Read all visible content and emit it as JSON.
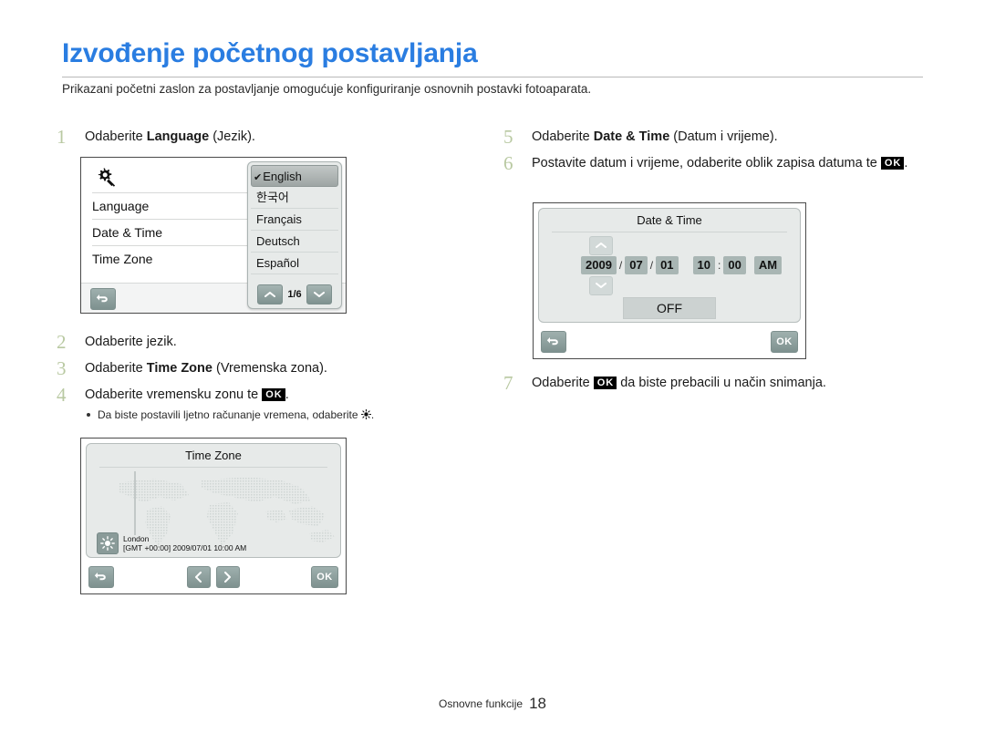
{
  "header": {
    "title": "Izvođenje početnog postavljanja",
    "subtitle": "Prikazani početni zaslon za postavljanje omogućuje konfiguriranje osnovnih postavki fotoaparata.",
    "title_color": "#2a7de1"
  },
  "steps_left": [
    {
      "num": "1",
      "pre": "Odaberite ",
      "bold": "Language",
      "post": " (Jezik)."
    },
    {
      "num": "2",
      "pre": "Odaberite jezik.",
      "bold": "",
      "post": ""
    },
    {
      "num": "3",
      "pre": "Odaberite ",
      "bold": "Time Zone",
      "post": " (Vremenska zona)."
    },
    {
      "num": "4",
      "pre": "Odaberite vremensku zonu te ",
      "bold": "",
      "post": "."
    }
  ],
  "step4_bullet": {
    "pre": "Da biste postavili ljetno računanje vremena, odaberite ",
    "post": "."
  },
  "steps_right": [
    {
      "num": "5",
      "pre": "Odaberite ",
      "bold": "Date & Time",
      "post": " (Datum i vrijeme)."
    },
    {
      "num": "6",
      "pre": "Postavite datum i vrijeme, odaberite oblik zapisa datuma te ",
      "bold": "",
      "post": "."
    },
    {
      "num": "7",
      "pre": "Odaberite ",
      "bold": "",
      "post": " da biste prebacili u način snimanja."
    }
  ],
  "ok_label": "OK",
  "screen_language": {
    "name": "setup-menu",
    "gear_icon": "gear-settings-icon",
    "rows": [
      "Language",
      "Date & Time",
      "Time Zone"
    ],
    "back_icon": "back-arrow-icon",
    "popup": {
      "items": [
        "English",
        "한국어",
        "Français",
        "Deutsch",
        "Español"
      ],
      "selected_index": 0,
      "check_glyph": "✔",
      "page_indicator": "1/6",
      "up_icon": "chevron-up-icon",
      "down_icon": "chevron-down-icon"
    }
  },
  "screen_timezone": {
    "title": "Time Zone",
    "city": "London",
    "gmt_line": "[GMT +00:00] 2009/07/01 10:00 AM",
    "sun_icon": "sun-dst-icon",
    "back_icon": "back-arrow-icon",
    "left_icon": "chevron-left-icon",
    "right_icon": "chevron-right-icon",
    "ok_label": "OK"
  },
  "screen_datetime": {
    "title": "Date & Time",
    "year": "2009",
    "month": "07",
    "day": "01",
    "hour": "10",
    "minute": "00",
    "meridiem": "AM",
    "date_sep": "/",
    "time_sep": ":",
    "format_toggle": "OFF",
    "up_icon": "chevron-up-icon",
    "down_icon": "chevron-down-icon",
    "back_icon": "back-arrow-icon",
    "ok_label": "OK"
  },
  "footer": {
    "section": "Osnovne funkcije",
    "page": "18"
  }
}
